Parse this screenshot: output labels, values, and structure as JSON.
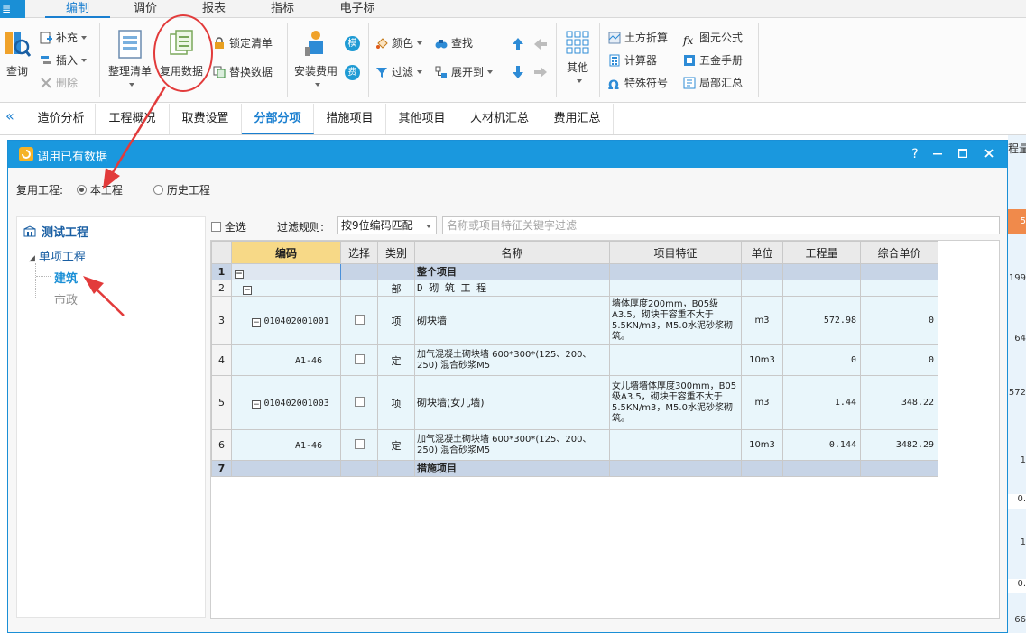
{
  "menubar": {
    "app_button": "≣",
    "tabs": [
      "编制",
      "调价",
      "报表",
      "指标",
      "电子标"
    ]
  },
  "ribbon": {
    "query": "查询",
    "supplement": "补充",
    "insert": "插入",
    "delete": "删除",
    "organize_list": "整理清单",
    "reuse_data": "复用数据",
    "lock_list": "锁定清单",
    "replace_data": "替换数据",
    "install_fee": "安装费用",
    "mo": "模",
    "fei": "费",
    "color": "颜色",
    "filter": "过滤",
    "search": "查找",
    "expand_to": "展开到",
    "other": "其他",
    "earthwork": "土方折算",
    "formula": "图元公式",
    "calculator": "计算器",
    "hardware_manual": "五金手册",
    "special_symbol": "特殊符号",
    "partial_summary": "局部汇总"
  },
  "doc_tabs": [
    "造价分析",
    "工程概况",
    "取费设置",
    "分部分项",
    "措施项目",
    "其他项目",
    "人材机汇总",
    "费用汇总"
  ],
  "dialog": {
    "title": "调用已有数据",
    "help": "?",
    "reuse_label": "复用工程:",
    "radio_current": "本工程",
    "radio_history": "历史工程",
    "select_all": "全选",
    "filter_rule_label": "过滤规则:",
    "filter_rule_value": "按9位编码匹配",
    "filter_placeholder": "名称或项目特征关键字过滤"
  },
  "tree": {
    "root": "测试工程",
    "group": "单项工程",
    "children": [
      "建筑",
      "市政"
    ]
  },
  "grid": {
    "headers": [
      "编码",
      "选择",
      "类别",
      "名称",
      "项目特征",
      "单位",
      "工程量",
      "综合单价"
    ],
    "rows": [
      {
        "no": "1",
        "code": "",
        "type": "",
        "name": "整个项目",
        "feature": "",
        "unit": "",
        "qty": "",
        "price": ""
      },
      {
        "no": "2",
        "code": "",
        "type": "部",
        "name": "D 砌 筑 工 程",
        "feature": "",
        "unit": "",
        "qty": "",
        "price": ""
      },
      {
        "no": "3",
        "code": "010402001001",
        "type": "项",
        "name": "砌块墙",
        "feature": "墙体厚度200mm，B05级A3.5，砌块干容重不大于5.5KN/m3，M5.0水泥砂浆砌筑。",
        "unit": "m3",
        "qty": "572.98",
        "price": "0"
      },
      {
        "no": "4",
        "code": "A1-46",
        "type": "定",
        "name": "加气混凝土砌块墙 600*300*(125、200、250) 混合砂浆M5",
        "feature": "",
        "unit": "10m3",
        "qty": "0",
        "price": "0"
      },
      {
        "no": "5",
        "code": "010402001003",
        "type": "项",
        "name": "砌块墙(女儿墙)",
        "feature": "女儿墙墙体厚度300mm，B05级A3.5，砌块干容重不大于5.5KN/m3，M5.0水泥砂浆砌筑。",
        "unit": "m3",
        "qty": "1.44",
        "price": "348.22"
      },
      {
        "no": "6",
        "code": "A1-46",
        "type": "定",
        "name": "加气混凝土砌块墙 600*300*(125、200、250) 混合砂浆M5",
        "feature": "",
        "unit": "10m3",
        "qty": "0.144",
        "price": "3482.29"
      },
      {
        "no": "7",
        "code": "",
        "type": "",
        "name": "措施项目",
        "feature": "",
        "unit": "",
        "qty": "",
        "price": ""
      }
    ]
  },
  "right_strip": {
    "header": "程量",
    "values": [
      "5",
      "199",
      "64",
      "572",
      "1",
      "0.",
      "1",
      "0.",
      "66"
    ]
  },
  "colors": {
    "accent": "#1a98de",
    "annotation": "#e23b3b",
    "sum_row": "#c7d4e6"
  }
}
